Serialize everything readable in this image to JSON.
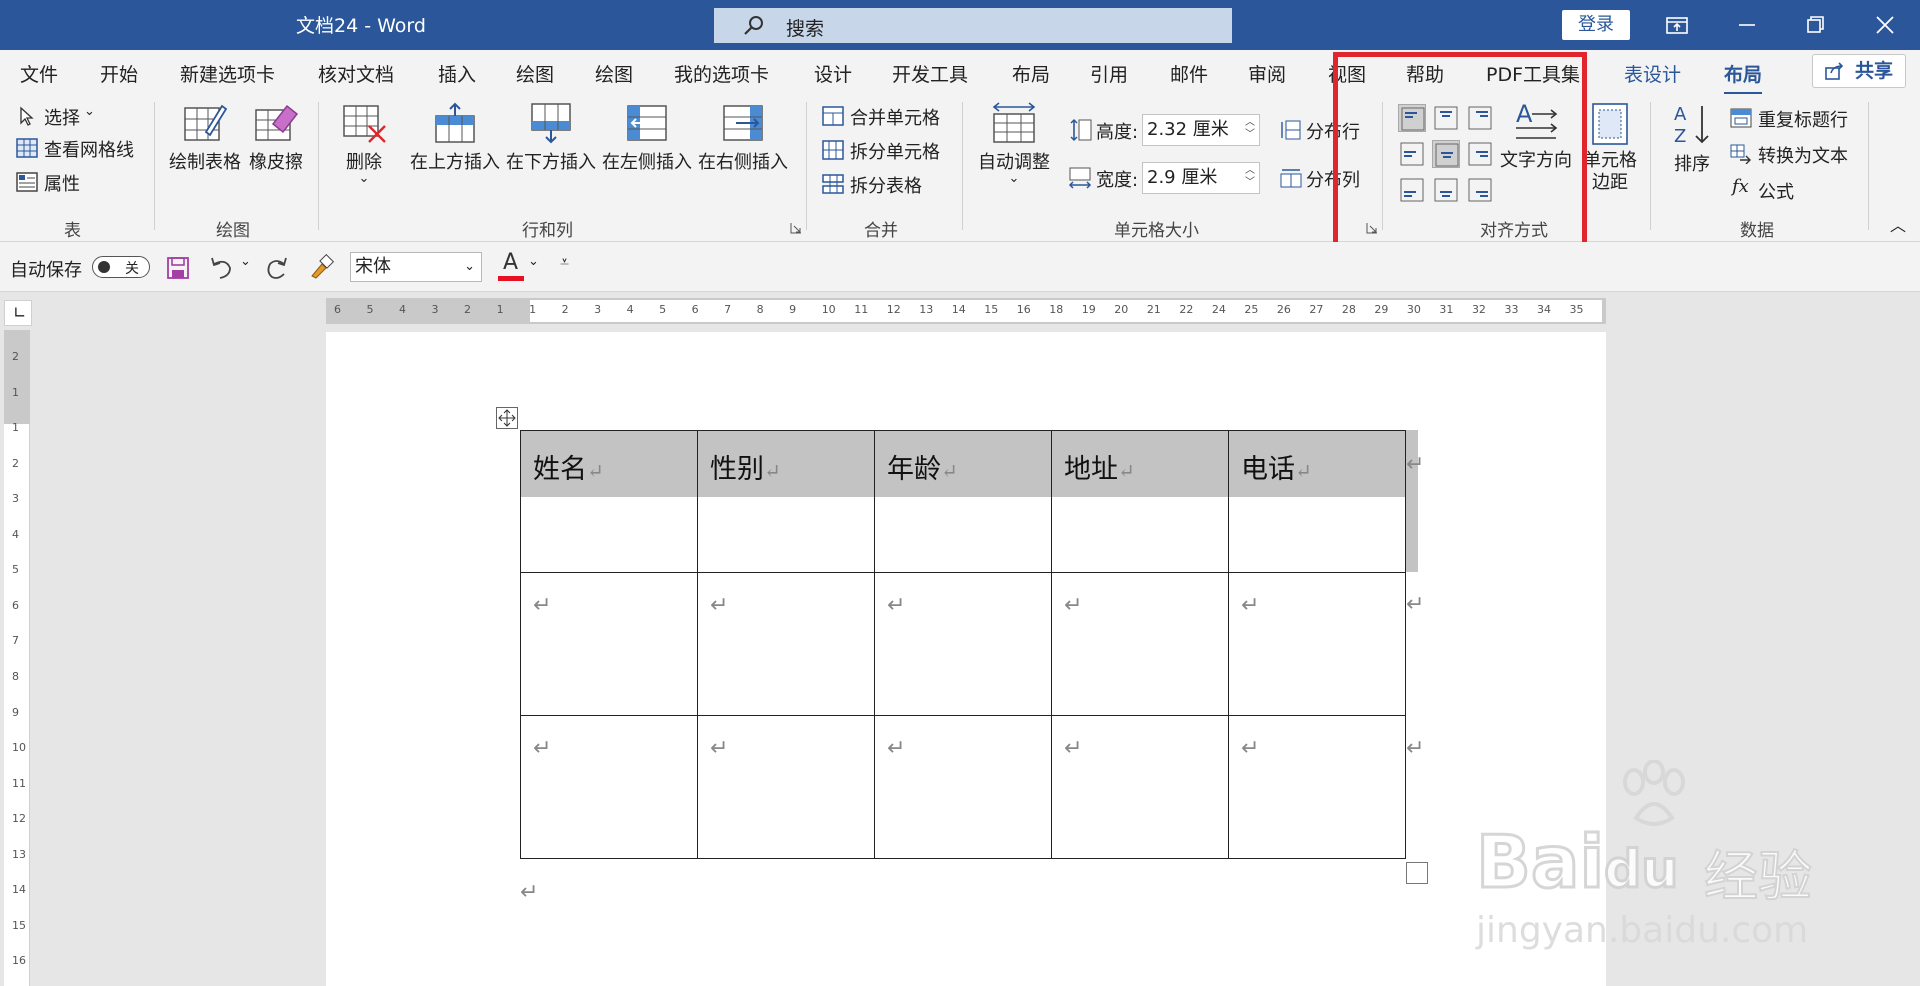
{
  "window": {
    "title": "文档24  -  Word",
    "search_placeholder": "搜索",
    "login": "登录"
  },
  "tabs": [
    {
      "label": "文件"
    },
    {
      "label": "开始"
    },
    {
      "label": "新建选项卡"
    },
    {
      "label": "核对文档"
    },
    {
      "label": "插入"
    },
    {
      "label": "绘图"
    },
    {
      "label": "绘图"
    },
    {
      "label": "我的选项卡"
    },
    {
      "label": "设计"
    },
    {
      "label": "开发工具"
    },
    {
      "label": "布局"
    },
    {
      "label": "引用"
    },
    {
      "label": "邮件"
    },
    {
      "label": "审阅"
    },
    {
      "label": "视图"
    },
    {
      "label": "帮助"
    },
    {
      "label": "PDF工具集"
    },
    {
      "label": "表设计"
    },
    {
      "label": "布局"
    }
  ],
  "share": "共享",
  "ribbon": {
    "table": {
      "select": "选择",
      "gridlines": "查看网格线",
      "properties": "属性",
      "label": "表"
    },
    "draw": {
      "draw_table": "绘制表格",
      "eraser": "橡皮擦",
      "label": "绘图"
    },
    "rows_cols": {
      "delete": "删除",
      "insert_above": "在上方插入",
      "insert_below": "在下方插入",
      "insert_left": "在左侧插入",
      "insert_right": "在右侧插入",
      "label": "行和列"
    },
    "merge": {
      "merge_cells": "合并单元格",
      "split_cells": "拆分单元格",
      "split_table": "拆分表格",
      "label": "合并"
    },
    "cell_size": {
      "autofit": "自动调整",
      "height_label": "高度:",
      "height_value": "2.32 厘米",
      "width_label": "宽度:",
      "width_value": "2.9 厘米",
      "distribute_rows": "分布行",
      "distribute_cols": "分布列",
      "label": "单元格大小"
    },
    "alignment": {
      "text_direction": "文字方向",
      "cell_margins_1": "单元格",
      "cell_margins_2": "边距",
      "label": "对齐方式"
    },
    "data": {
      "sort": "排序",
      "repeat_header": "重复标题行",
      "convert_text": "转换为文本",
      "formula": "公式",
      "label": "数据"
    }
  },
  "qat": {
    "autosave": "自动保存",
    "autosave_state": "关",
    "font": "宋体"
  },
  "ruler_h": [
    "6",
    "5",
    "4",
    "3",
    "2",
    "1",
    "1",
    "2",
    "3",
    "4",
    "5",
    "6",
    "7",
    "8",
    "9",
    "10",
    "11",
    "12",
    "13",
    "14",
    "15",
    "16",
    "18",
    "19",
    "20",
    "21",
    "22",
    "24",
    "25",
    "26",
    "27",
    "28",
    "29",
    "30",
    "31",
    "32",
    "33",
    "34",
    "35"
  ],
  "ruler_v": [
    "2",
    "1",
    "1",
    "2",
    "3",
    "4",
    "5",
    "6",
    "7",
    "8",
    "9",
    "10",
    "11",
    "12",
    "13",
    "14",
    "15",
    "16"
  ],
  "document": {
    "headers": [
      "姓名",
      "性别",
      "年龄",
      "地址",
      "电话"
    ],
    "para_mark": "↵"
  },
  "watermark": {
    "brand": "Bai",
    "brand2": "du",
    "cn": "经验",
    "url": "jingyan.baidu.com"
  },
  "colors": {
    "accent": "#2b579a",
    "highlight_frame": "#e0262c",
    "font_color": "#e81123"
  }
}
